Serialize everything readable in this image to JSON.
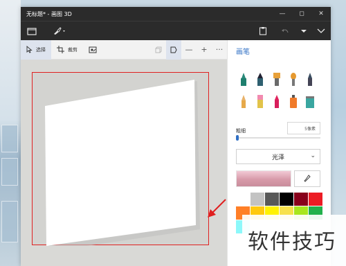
{
  "window": {
    "title": "无标题* - 画图 3D"
  },
  "toolbar": {
    "select_label": "选择",
    "crop_label": "裁剪"
  },
  "panel": {
    "title": "画笔",
    "thickness_label": "粗细",
    "thickness_value": "5像素",
    "finish_value": "光泽",
    "brushes": [
      {
        "icon": "marker-teal-icon"
      },
      {
        "icon": "calligraphy-pen-icon"
      },
      {
        "icon": "oil-brush-icon"
      },
      {
        "icon": "watercolor-icon"
      },
      {
        "icon": "pixel-pen-icon"
      },
      {
        "icon": "pencil-icon"
      },
      {
        "icon": "eraser-icon"
      },
      {
        "icon": "crayon-icon"
      },
      {
        "icon": "spray-can-icon"
      },
      {
        "icon": "fill-bucket-icon"
      }
    ],
    "palette": [
      "#ffffff",
      "#c3c3c3",
      "#585858",
      "#000000",
      "#88001b",
      "#ec1c24",
      "#ff7f27",
      "#ffc90e",
      "#fff200",
      "#f7e14b",
      "#a8e61d",
      "#22b14c",
      "#8cf8fa",
      "#ffffff",
      "#ffffff",
      "#ffffff",
      "#ffffff",
      "#ffffff"
    ]
  },
  "watermark": {
    "text": "软件技巧"
  }
}
